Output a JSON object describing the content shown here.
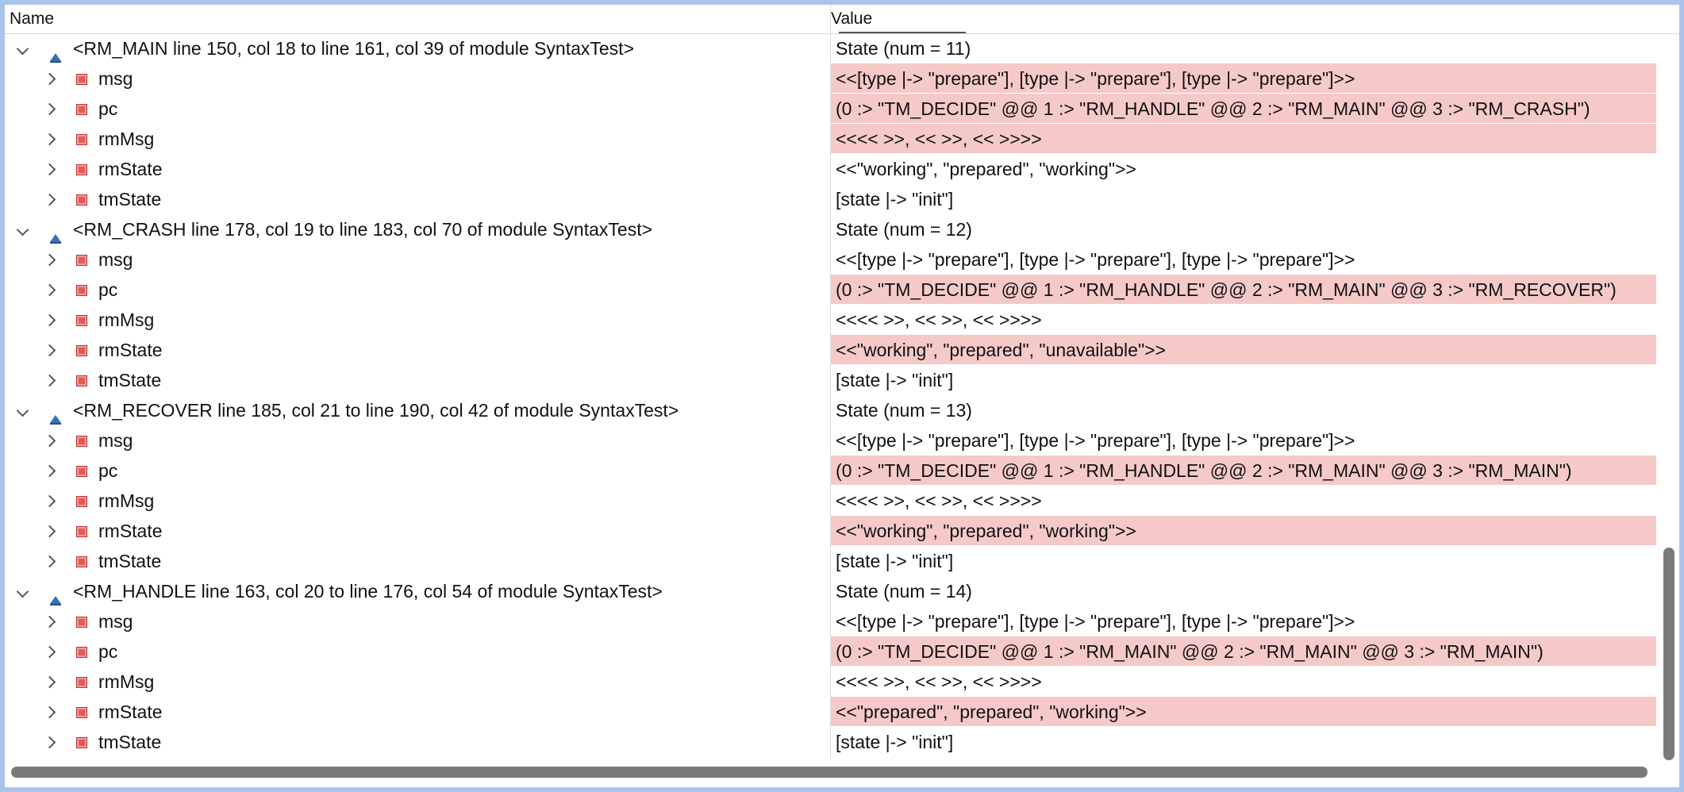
{
  "columns": {
    "name": "Name",
    "value": "Value"
  },
  "states": [
    {
      "label": "<RM_MAIN line 150, col 18 to line 161, col 39 of module SyntaxTest>",
      "value": "State (num = 11)",
      "vars": [
        {
          "name": "msg",
          "value": "<<[type |-> \"prepare\"], [type |-> \"prepare\"], [type |-> \"prepare\"]>>",
          "changed": true
        },
        {
          "name": "pc",
          "value": "(0 :> \"TM_DECIDE\" @@ 1 :> \"RM_HANDLE\" @@ 2 :> \"RM_MAIN\" @@ 3 :> \"RM_CRASH\")",
          "changed": true
        },
        {
          "name": "rmMsg",
          "value": "<<<< >>, << >>, << >>>>",
          "changed": true
        },
        {
          "name": "rmState",
          "value": "<<\"working\", \"prepared\", \"working\">>",
          "changed": false
        },
        {
          "name": "tmState",
          "value": "[state |-> \"init\"]",
          "changed": false
        }
      ]
    },
    {
      "label": "<RM_CRASH line 178, col 19 to line 183, col 70 of module SyntaxTest>",
      "value": "State (num = 12)",
      "vars": [
        {
          "name": "msg",
          "value": "<<[type |-> \"prepare\"], [type |-> \"prepare\"], [type |-> \"prepare\"]>>",
          "changed": false
        },
        {
          "name": "pc",
          "value": "(0 :> \"TM_DECIDE\" @@ 1 :> \"RM_HANDLE\" @@ 2 :> \"RM_MAIN\" @@ 3 :> \"RM_RECOVER\")",
          "changed": true
        },
        {
          "name": "rmMsg",
          "value": "<<<< >>, << >>, << >>>>",
          "changed": false
        },
        {
          "name": "rmState",
          "value": "<<\"working\", \"prepared\", \"unavailable\">>",
          "changed": true
        },
        {
          "name": "tmState",
          "value": "[state |-> \"init\"]",
          "changed": false
        }
      ]
    },
    {
      "label": "<RM_RECOVER line 185, col 21 to line 190, col 42 of module SyntaxTest>",
      "value": "State (num = 13)",
      "vars": [
        {
          "name": "msg",
          "value": "<<[type |-> \"prepare\"], [type |-> \"prepare\"], [type |-> \"prepare\"]>>",
          "changed": false
        },
        {
          "name": "pc",
          "value": "(0 :> \"TM_DECIDE\" @@ 1 :> \"RM_HANDLE\" @@ 2 :> \"RM_MAIN\" @@ 3 :> \"RM_MAIN\")",
          "changed": true
        },
        {
          "name": "rmMsg",
          "value": "<<<< >>, << >>, << >>>>",
          "changed": false
        },
        {
          "name": "rmState",
          "value": "<<\"working\", \"prepared\", \"working\">>",
          "changed": true
        },
        {
          "name": "tmState",
          "value": "[state |-> \"init\"]",
          "changed": false
        }
      ]
    },
    {
      "label": "<RM_HANDLE line 163, col 20 to line 176, col 54 of module SyntaxTest>",
      "value": "State (num = 14)",
      "vars": [
        {
          "name": "msg",
          "value": "<<[type |-> \"prepare\"], [type |-> \"prepare\"], [type |-> \"prepare\"]>>",
          "changed": false
        },
        {
          "name": "pc",
          "value": "(0 :> \"TM_DECIDE\" @@ 1 :> \"RM_MAIN\" @@ 2 :> \"RM_MAIN\" @@ 3 :> \"RM_MAIN\")",
          "changed": true
        },
        {
          "name": "rmMsg",
          "value": "<<<< >>, << >>, << >>>>",
          "changed": false
        },
        {
          "name": "rmState",
          "value": "<<\"prepared\", \"prepared\", \"working\">>",
          "changed": true
        },
        {
          "name": "tmState",
          "value": "[state |-> \"init\"]",
          "changed": false
        }
      ]
    }
  ],
  "colors": {
    "changed_highlight": "#f6c9c9",
    "variable_icon": "#e15a5a",
    "state_icon": "#3a6fb8",
    "window_border": "#a9c3ec"
  },
  "icons": {
    "state": "state-triangle-icon",
    "variable": "variable-square-icon",
    "expanded": "chevron-down-icon",
    "collapsed": "chevron-right-icon"
  }
}
